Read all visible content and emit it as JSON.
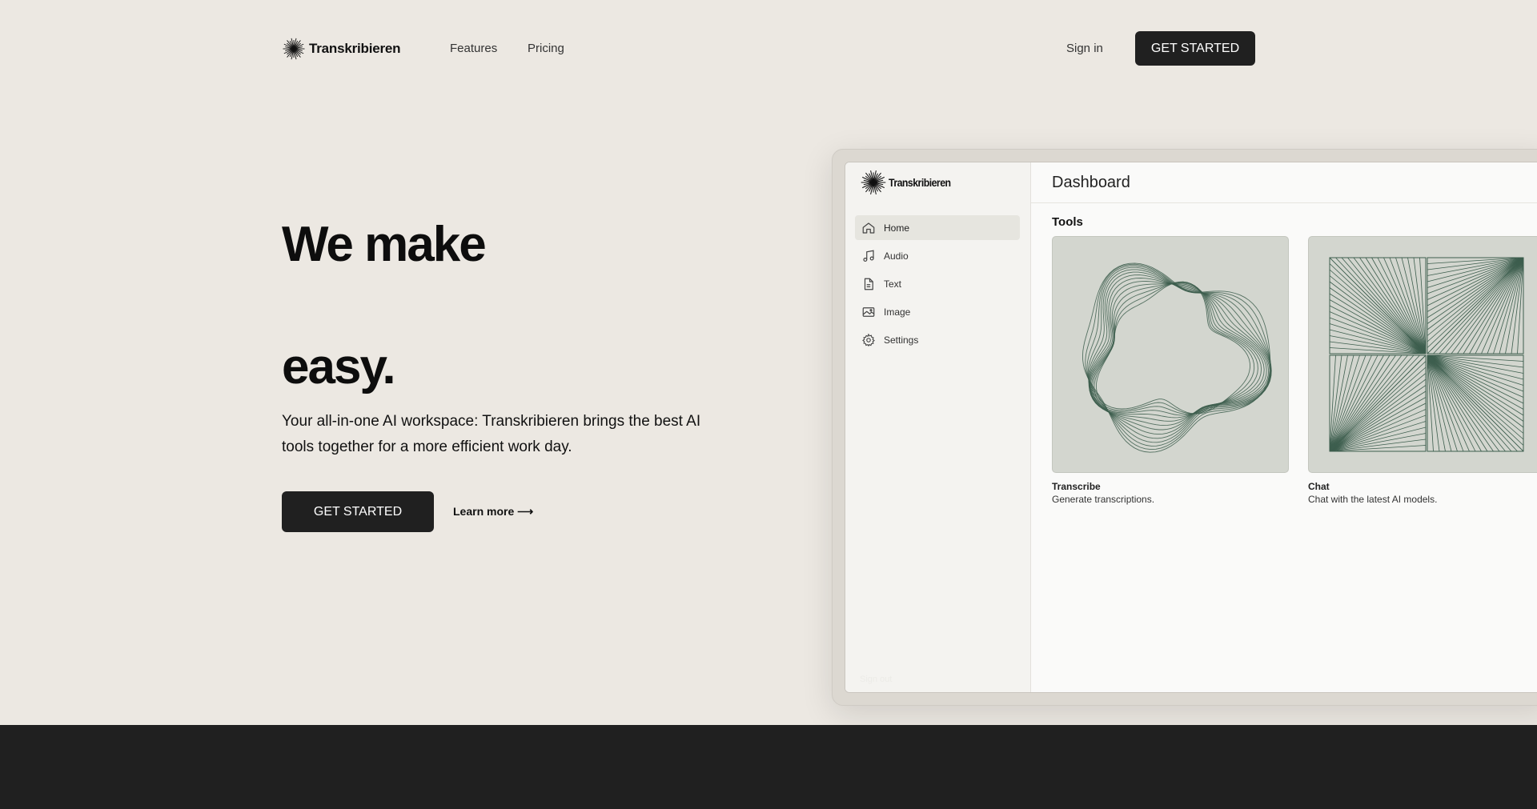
{
  "header": {
    "brand": "Transkribieren",
    "nav": [
      "Features",
      "Pricing"
    ],
    "sign_in": "Sign in",
    "cta": "GET STARTED"
  },
  "hero": {
    "title_line1": "We make",
    "title_line2": "easy.",
    "subtitle": "Your all-in-one AI workspace: Transkribieren brings the best AI tools together for a more efficient work day.",
    "cta": "GET STARTED",
    "learn_more": "Learn more ⟶"
  },
  "mockup": {
    "brand": "Transkribieren",
    "page_title": "Dashboard",
    "sidebar": [
      {
        "label": "Home",
        "icon": "home-icon",
        "active": true
      },
      {
        "label": "Audio",
        "icon": "music-note-icon",
        "active": false
      },
      {
        "label": "Text",
        "icon": "document-icon",
        "active": false
      },
      {
        "label": "Image",
        "icon": "image-icon",
        "active": false
      },
      {
        "label": "Settings",
        "icon": "gear-icon",
        "active": false
      }
    ],
    "sign_out": "Sign out",
    "section_title": "Tools",
    "tools": [
      {
        "title": "Transcribe",
        "description": "Generate transcriptions."
      },
      {
        "title": "Chat",
        "description": "Chat with the latest AI models."
      }
    ]
  },
  "colors": {
    "background": "#ece8e2",
    "dark": "#202020",
    "accent_green": "#3d5e4e",
    "card_bg": "#d3d6cf"
  }
}
